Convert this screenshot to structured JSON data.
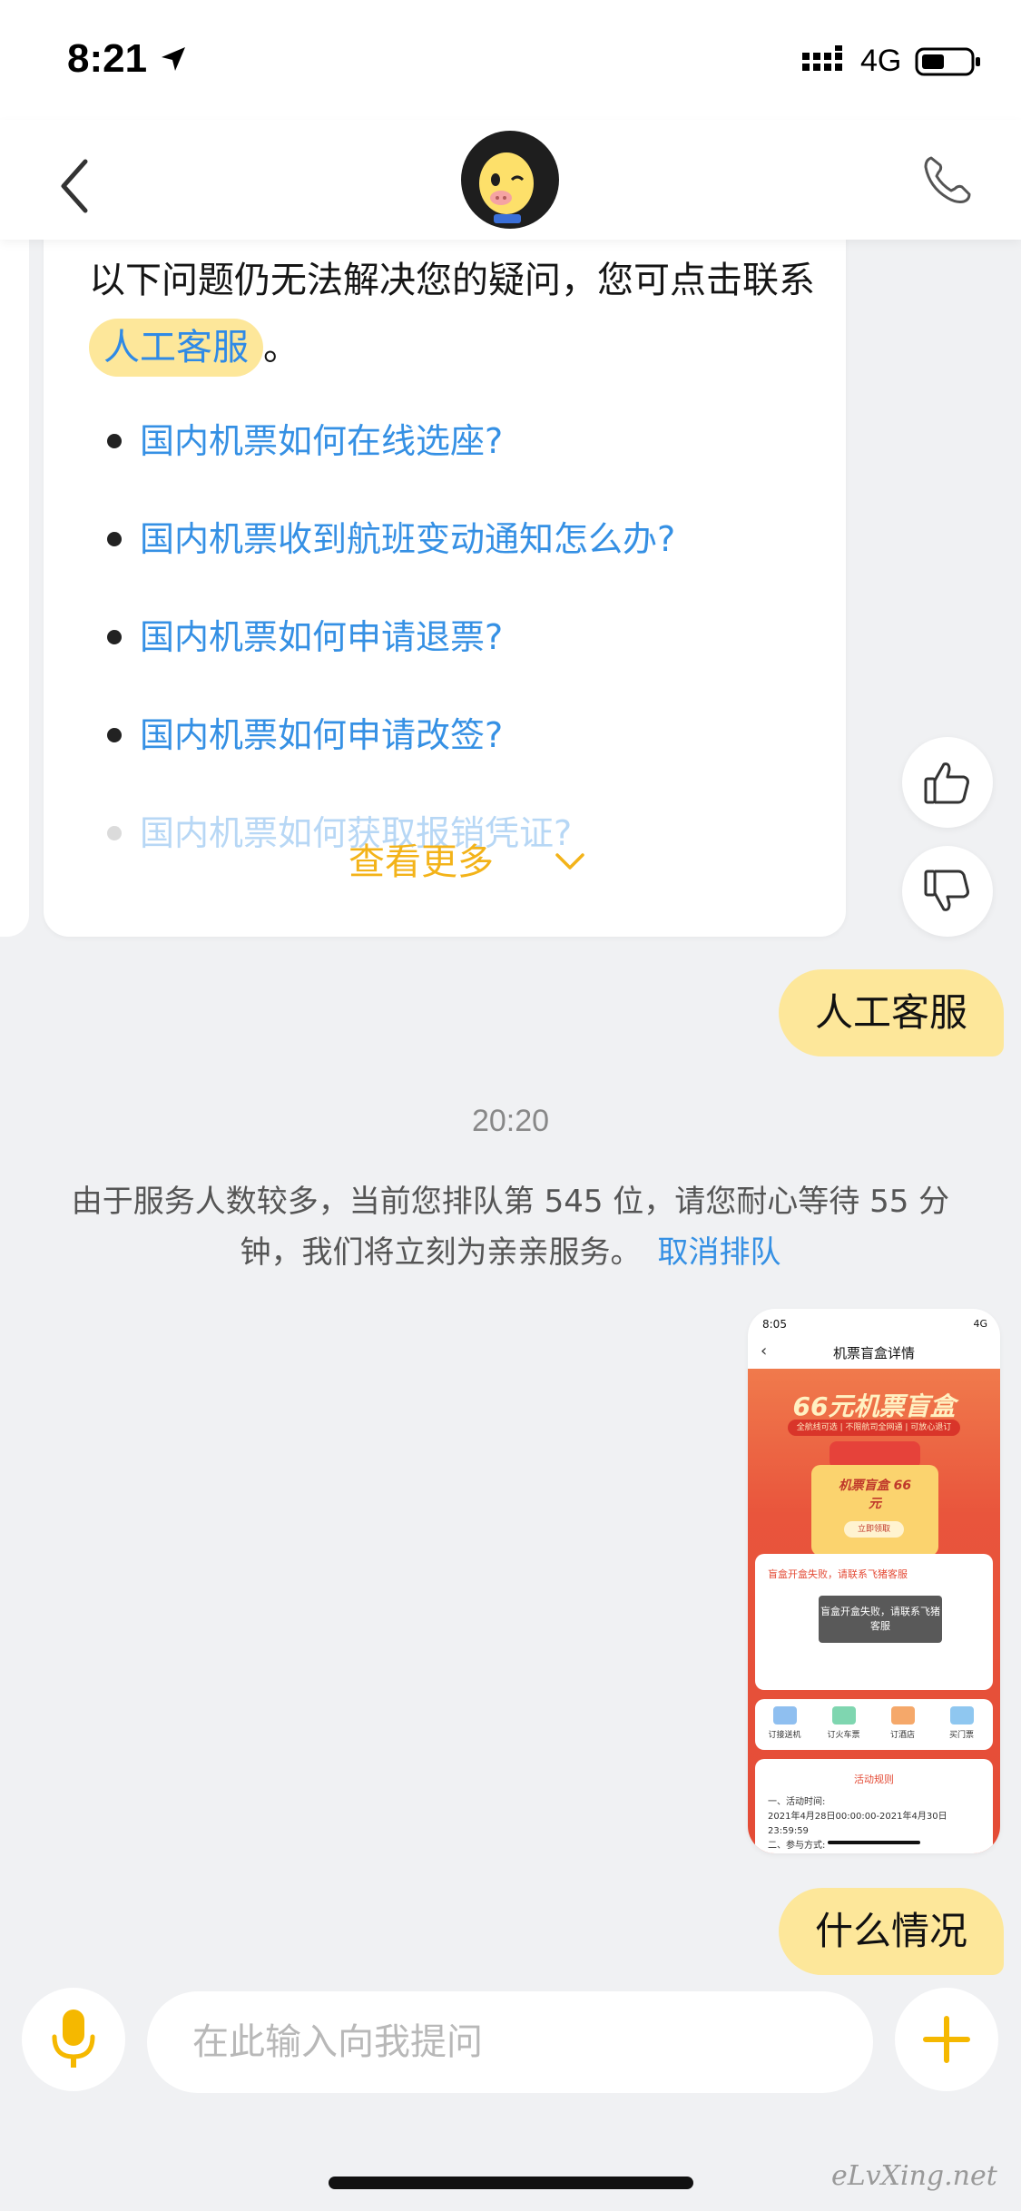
{
  "status_bar": {
    "time": "8:21",
    "network": "4G",
    "icons": [
      "location-arrow-icon",
      "signal-icon",
      "battery-icon"
    ]
  },
  "nav": {
    "icons": [
      "back-chevron-icon",
      "pig-mascot-avatar",
      "phone-icon"
    ]
  },
  "faq": {
    "intro_before": "以下问题仍无法解决您的疑问，您可点击联系",
    "intro_link": "人工客服",
    "intro_after": "。",
    "items": [
      "国内机票如何在线选座?",
      "国内机票收到航班变动通知怎么办?",
      "国内机票如何申请退票?",
      "国内机票如何申请改签?",
      "国内机票如何获取报销凭证?"
    ],
    "see_more": "查看更多"
  },
  "chat": {
    "user_message_1": "人工客服",
    "timestamp": "20:20",
    "system_message": "由于服务人数较多，当前您排队第 545 位，请您耐心等待 55 分钟，我们将立刻为亲亲服务。",
    "cancel_queue": "取消排队",
    "user_message_2": "什么情况"
  },
  "screenshot_thumb": {
    "time": "8:05",
    "network": "4G",
    "title": "机票盲盒详情",
    "hero_title": "66元机票盲盒",
    "hero_sub": "全航线可选 | 不限航司全网通 | 可放心退订",
    "gift_label": "机票盲盒 66元",
    "gift_button": "立即领取",
    "panel_text": "盲盒开盒失败，请联系飞猪客服",
    "toast": "盲盒开盒失败，请联系飞猪客服",
    "icons": [
      "订接送机",
      "订火车票",
      "订酒店",
      "买门票"
    ],
    "rules_title": "活动规则",
    "rules_lines": [
      "一、活动时间:",
      "2021年4月28日00:00:00-2021年4月30日23:59:59",
      "二、参与方式:"
    ]
  },
  "input": {
    "placeholder": "在此输入向我提问"
  },
  "watermark": "eLvXing.net",
  "colors": {
    "accent_yellow": "#fde79a",
    "link_blue": "#3590e4",
    "see_more_orange": "#f3b319"
  }
}
